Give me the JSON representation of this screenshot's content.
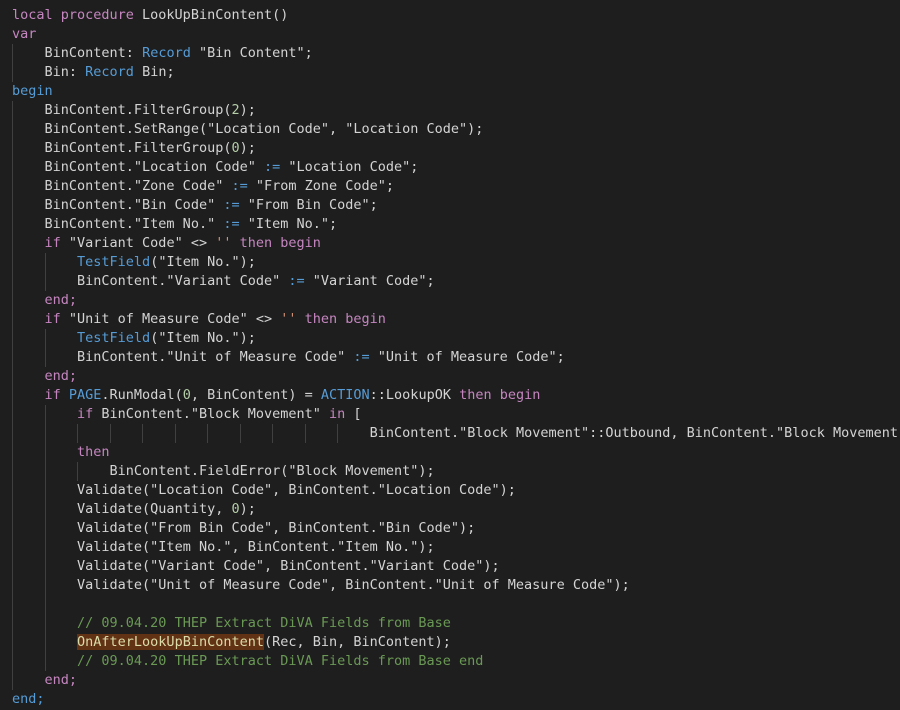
{
  "editor": {
    "language": "AL",
    "colors": {
      "background": "#1e1e1e",
      "plain": "#d4d4d4",
      "keyword": "#c586c0",
      "declaration": "#569cd6",
      "function": "#dcdcaa",
      "string": "#ce9178",
      "number": "#b5cea8",
      "comment": "#6a9955",
      "highlight_bg": "#613214",
      "guide": "#404040"
    },
    "lines": [
      {
        "indent": 0,
        "tokens": [
          [
            "local procedure ",
            "kw"
          ],
          [
            "LookUpBinContent()",
            ""
          ]
        ]
      },
      {
        "indent": 0,
        "tokens": [
          [
            "var",
            "kw"
          ]
        ]
      },
      {
        "indent": 1,
        "tokens": [
          [
            "BinContent: ",
            ""
          ],
          [
            "Record",
            "kw2"
          ],
          [
            " \"Bin Content\";",
            ""
          ]
        ]
      },
      {
        "indent": 1,
        "tokens": [
          [
            "Bin: ",
            ""
          ],
          [
            "Record",
            "kw2"
          ],
          [
            " Bin;",
            ""
          ]
        ]
      },
      {
        "indent": 0,
        "tokens": [
          [
            "begin",
            "kw2"
          ]
        ]
      },
      {
        "indent": 1,
        "tokens": [
          [
            "BinContent.FilterGroup(",
            ""
          ],
          [
            "2",
            "num"
          ],
          [
            ");",
            ""
          ]
        ]
      },
      {
        "indent": 1,
        "tokens": [
          [
            "BinContent.SetRange(\"Location Code\", \"Location Code\");",
            ""
          ]
        ]
      },
      {
        "indent": 1,
        "tokens": [
          [
            "BinContent.FilterGroup(",
            ""
          ],
          [
            "0",
            "num"
          ],
          [
            ");",
            ""
          ]
        ]
      },
      {
        "indent": 1,
        "tokens": [
          [
            "BinContent.\"Location Code\" ",
            ""
          ],
          [
            ":=",
            "kw2"
          ],
          [
            " \"Location Code\";",
            ""
          ]
        ]
      },
      {
        "indent": 1,
        "tokens": [
          [
            "BinContent.\"Zone Code\" ",
            ""
          ],
          [
            ":=",
            "kw2"
          ],
          [
            " \"From Zone Code\";",
            ""
          ]
        ]
      },
      {
        "indent": 1,
        "tokens": [
          [
            "BinContent.\"Bin Code\" ",
            ""
          ],
          [
            ":=",
            "kw2"
          ],
          [
            " \"From Bin Code\";",
            ""
          ]
        ]
      },
      {
        "indent": 1,
        "tokens": [
          [
            "BinContent.\"Item No.\" ",
            ""
          ],
          [
            ":=",
            "kw2"
          ],
          [
            " \"Item No.\";",
            ""
          ]
        ]
      },
      {
        "indent": 1,
        "tokens": [
          [
            "if ",
            "kw"
          ],
          [
            "\"Variant Code\" <> ",
            ""
          ],
          [
            "''",
            "str"
          ],
          [
            " then begin",
            "kw"
          ]
        ]
      },
      {
        "indent": 2,
        "tokens": [
          [
            "TestField",
            "kw2"
          ],
          [
            "(\"Item No.\");",
            ""
          ]
        ]
      },
      {
        "indent": 2,
        "tokens": [
          [
            "BinContent.\"Variant Code\" ",
            ""
          ],
          [
            ":=",
            "kw2"
          ],
          [
            " \"Variant Code\";",
            ""
          ]
        ]
      },
      {
        "indent": 1,
        "tokens": [
          [
            "end;",
            "kw"
          ]
        ]
      },
      {
        "indent": 1,
        "tokens": [
          [
            "if ",
            "kw"
          ],
          [
            "\"Unit of Measure Code\" <> ",
            ""
          ],
          [
            "''",
            "str"
          ],
          [
            " then begin",
            "kw"
          ]
        ]
      },
      {
        "indent": 2,
        "tokens": [
          [
            "TestField",
            "kw2"
          ],
          [
            "(\"Item No.\");",
            ""
          ]
        ]
      },
      {
        "indent": 2,
        "tokens": [
          [
            "BinContent.\"Unit of Measure Code\" ",
            ""
          ],
          [
            ":=",
            "kw2"
          ],
          [
            " \"Unit of Measure Code\";",
            ""
          ]
        ]
      },
      {
        "indent": 1,
        "tokens": [
          [
            "end;",
            "kw"
          ]
        ]
      },
      {
        "indent": 1,
        "tokens": [
          [
            "if ",
            "kw"
          ],
          [
            "PAGE",
            "kw2"
          ],
          [
            ".RunModal(",
            ""
          ],
          [
            "0",
            "num"
          ],
          [
            ", BinContent) = ",
            ""
          ],
          [
            "ACTION",
            "kw2"
          ],
          [
            "::LookupOK",
            ""
          ],
          [
            " then begin",
            "kw"
          ]
        ]
      },
      {
        "indent": 2,
        "tokens": [
          [
            "if ",
            "kw"
          ],
          [
            "BinContent.\"Block Movement\" ",
            ""
          ],
          [
            "in",
            "kw"
          ],
          [
            " [",
            ""
          ]
        ]
      },
      {
        "indent": 11,
        "tokens": [
          [
            "BinContent.\"Block Movement\"::Outbound, BinContent.\"Block Movement\"::All]",
            ""
          ]
        ]
      },
      {
        "indent": 2,
        "tokens": [
          [
            "then",
            "kw"
          ]
        ]
      },
      {
        "indent": 3,
        "tokens": [
          [
            "BinContent.FieldError(\"Block Movement\");",
            ""
          ]
        ]
      },
      {
        "indent": 2,
        "tokens": [
          [
            "Validate(\"Location Code\", BinContent.\"Location Code\");",
            ""
          ]
        ]
      },
      {
        "indent": 2,
        "tokens": [
          [
            "Validate(Quantity, ",
            ""
          ],
          [
            "0",
            "num"
          ],
          [
            ");",
            ""
          ]
        ]
      },
      {
        "indent": 2,
        "tokens": [
          [
            "Validate(\"From Bin Code\", BinContent.\"Bin Code\");",
            ""
          ]
        ]
      },
      {
        "indent": 2,
        "tokens": [
          [
            "Validate(\"Item No.\", BinContent.\"Item No.\");",
            ""
          ]
        ]
      },
      {
        "indent": 2,
        "tokens": [
          [
            "Validate(\"Variant Code\", BinContent.\"Variant Code\");",
            ""
          ]
        ]
      },
      {
        "indent": 2,
        "tokens": [
          [
            "Validate(\"Unit of Measure Code\", BinContent.\"Unit of Measure Code\");",
            ""
          ]
        ]
      },
      {
        "indent": 2,
        "tokens": []
      },
      {
        "indent": 2,
        "tokens": [
          [
            "// 09.04.20 THEP Extract DiVA Fields from Base",
            "cm"
          ]
        ]
      },
      {
        "indent": 2,
        "tokens": [
          [
            "OnAfterLookUpBinContent",
            "hl"
          ],
          [
            "(Rec, Bin, BinContent);",
            ""
          ]
        ]
      },
      {
        "indent": 2,
        "tokens": [
          [
            "// 09.04.20 THEP Extract DiVA Fields from Base end",
            "cm"
          ]
        ]
      },
      {
        "indent": 1,
        "tokens": [
          [
            "end;",
            "kw"
          ]
        ]
      },
      {
        "indent": 0,
        "tokens": [
          [
            "end;",
            "kw2"
          ]
        ]
      }
    ]
  }
}
